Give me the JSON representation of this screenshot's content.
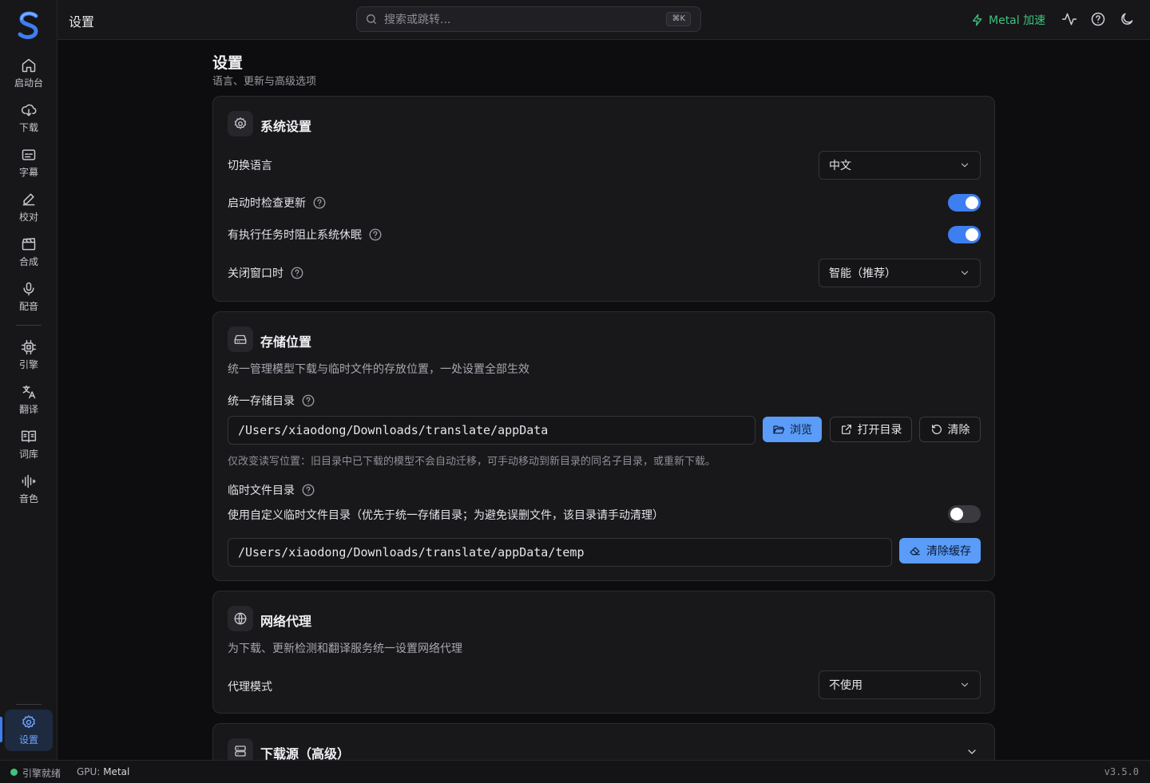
{
  "sidebar": {
    "items": [
      {
        "label": "启动台",
        "icon": "home-icon"
      },
      {
        "label": "下载",
        "icon": "cloud-download-icon"
      },
      {
        "label": "字幕",
        "icon": "subtitles-icon"
      },
      {
        "label": "校对",
        "icon": "pencil-icon"
      },
      {
        "label": "合成",
        "icon": "clapperboard-icon"
      },
      {
        "label": "配音",
        "icon": "microphone-icon"
      },
      {
        "label": "引擎",
        "icon": "cpu-icon"
      },
      {
        "label": "翻译",
        "icon": "translate-icon"
      },
      {
        "label": "词库",
        "icon": "book-icon"
      },
      {
        "label": "音色",
        "icon": "audio-wave-icon"
      }
    ],
    "settings": {
      "label": "设置",
      "icon": "gear-icon",
      "active": true
    }
  },
  "header": {
    "title": "设置",
    "search_placeholder": "搜索或跳转...",
    "search_shortcut": "⌘K",
    "metal_label": "Metal 加速",
    "accent_color": "#3fc27a"
  },
  "page": {
    "title": "设置",
    "subtitle": "语言、更新与高级选项"
  },
  "system": {
    "title": "系统设置",
    "language_label": "切换语言",
    "language_value": "中文",
    "check_update_label": "启动时检查更新",
    "check_update_on": true,
    "prevent_sleep_label": "有执行任务时阻止系统休眠",
    "prevent_sleep_on": true,
    "close_window_label": "关闭窗口时",
    "close_window_value": "智能（推荐）"
  },
  "storage": {
    "title": "存储位置",
    "description": "统一管理模型下载与临时文件的存放位置，一处设置全部生效",
    "unified_dir_label": "统一存储目录",
    "unified_dir_value": "/Users/xiaodong/Downloads/translate/appData",
    "browse_label": "浏览",
    "open_dir_label": "打开目录",
    "clear_label": "清除",
    "hint": "仅改变读写位置：旧目录中已下载的模型不会自动迁移，可手动移动到新目录的同名子目录，或重新下载。",
    "temp_dir_label": "临时文件目录",
    "custom_temp_label": "使用自定义临时文件目录（优先于统一存储目录；为避免误删文件，该目录请手动清理）",
    "custom_temp_on": false,
    "temp_dir_value": "/Users/xiaodong/Downloads/translate/appData/temp",
    "clear_cache_label": "清除缓存"
  },
  "proxy": {
    "title": "网络代理",
    "description": "为下载、更新检测和翻译服务统一设置网络代理",
    "mode_label": "代理模式",
    "mode_value": "不使用"
  },
  "download_source": {
    "title": "下载源（高级）"
  },
  "status": {
    "engine_status": "引擎就绪",
    "gpu_label": "GPU:",
    "gpu_value": "Metal",
    "version": "v3.5.0",
    "ok_color": "#3fc27a"
  }
}
